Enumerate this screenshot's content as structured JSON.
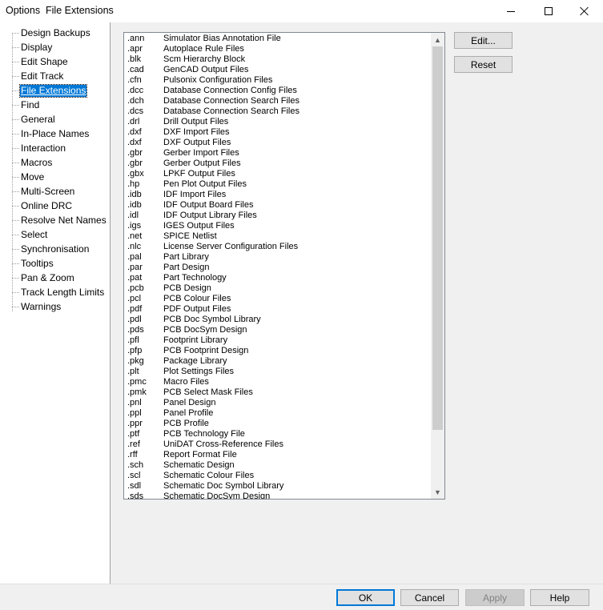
{
  "window": {
    "title": "Options  File Extensions"
  },
  "tree": {
    "selected_index": 4,
    "items": [
      "Design Backups",
      "Display",
      "Edit Shape",
      "Edit Track",
      "File Extensions",
      "Find",
      "General",
      "In-Place Names",
      "Interaction",
      "Macros",
      "Move",
      "Multi-Screen",
      "Online DRC",
      "Resolve Net Names",
      "Select",
      "Synchronisation",
      "Tooltips",
      "Pan & Zoom",
      "Track Length Limits",
      "Warnings"
    ]
  },
  "extensions": [
    {
      "ext": ".ann",
      "desc": "Simulator Bias Annotation File"
    },
    {
      "ext": ".apr",
      "desc": "Autoplace Rule Files"
    },
    {
      "ext": ".blk",
      "desc": "Scm Hierarchy Block"
    },
    {
      "ext": ".cad",
      "desc": "GenCAD Output Files"
    },
    {
      "ext": ".cfn",
      "desc": "Pulsonix Configuration Files"
    },
    {
      "ext": ".dcc",
      "desc": "Database Connection Config Files"
    },
    {
      "ext": ".dch",
      "desc": "Database Connection Search Files"
    },
    {
      "ext": ".dcs",
      "desc": "Database Connection Search Files"
    },
    {
      "ext": ".drl",
      "desc": "Drill Output Files"
    },
    {
      "ext": ".dxf",
      "desc": "DXF Import Files"
    },
    {
      "ext": ".dxf",
      "desc": "DXF Output Files"
    },
    {
      "ext": ".gbr",
      "desc": "Gerber Import Files"
    },
    {
      "ext": ".gbr",
      "desc": "Gerber Output Files"
    },
    {
      "ext": ".gbx",
      "desc": "LPKF Output Files"
    },
    {
      "ext": ".hp",
      "desc": "Pen Plot Output Files"
    },
    {
      "ext": ".idb",
      "desc": "IDF Import Files"
    },
    {
      "ext": ".idb",
      "desc": "IDF Output Board Files"
    },
    {
      "ext": ".idl",
      "desc": "IDF Output Library Files"
    },
    {
      "ext": ".igs",
      "desc": "IGES Output Files"
    },
    {
      "ext": ".net",
      "desc": "SPICE Netlist"
    },
    {
      "ext": ".nlc",
      "desc": "License Server Configuration Files"
    },
    {
      "ext": ".pal",
      "desc": "Part Library"
    },
    {
      "ext": ".par",
      "desc": "Part Design"
    },
    {
      "ext": ".pat",
      "desc": "Part Technology"
    },
    {
      "ext": ".pcb",
      "desc": "PCB Design"
    },
    {
      "ext": ".pcl",
      "desc": "PCB Colour Files"
    },
    {
      "ext": ".pdf",
      "desc": "PDF Output Files"
    },
    {
      "ext": ".pdl",
      "desc": "PCB Doc Symbol Library"
    },
    {
      "ext": ".pds",
      "desc": "PCB DocSym Design"
    },
    {
      "ext": ".pfl",
      "desc": "Footprint Library"
    },
    {
      "ext": ".pfp",
      "desc": "PCB Footprint Design"
    },
    {
      "ext": ".pkg",
      "desc": "Package Library"
    },
    {
      "ext": ".plt",
      "desc": "Plot Settings Files"
    },
    {
      "ext": ".pmc",
      "desc": "Macro Files"
    },
    {
      "ext": ".pmk",
      "desc": "PCB Select Mask Files"
    },
    {
      "ext": ".pnl",
      "desc": "Panel Design"
    },
    {
      "ext": ".ppl",
      "desc": "Panel Profile"
    },
    {
      "ext": ".ppr",
      "desc": "PCB Profile"
    },
    {
      "ext": ".ptf",
      "desc": "PCB Technology File"
    },
    {
      "ext": ".ref",
      "desc": "UniDAT Cross-Reference Files"
    },
    {
      "ext": ".rff",
      "desc": "Report Format File"
    },
    {
      "ext": ".sch",
      "desc": "Schematic Design"
    },
    {
      "ext": ".scl",
      "desc": "Schematic Colour Files"
    },
    {
      "ext": ".sdl",
      "desc": "Schematic Doc Symbol Library"
    },
    {
      "ext": ".sds",
      "desc": "Schematic DocSym Design"
    }
  ],
  "side_buttons": {
    "edit": "Edit...",
    "reset": "Reset"
  },
  "footer_buttons": {
    "ok": "OK",
    "cancel": "Cancel",
    "apply": "Apply",
    "help": "Help"
  },
  "colors": {
    "selection": "#0078d7",
    "default_button_border": "#0078d7"
  }
}
